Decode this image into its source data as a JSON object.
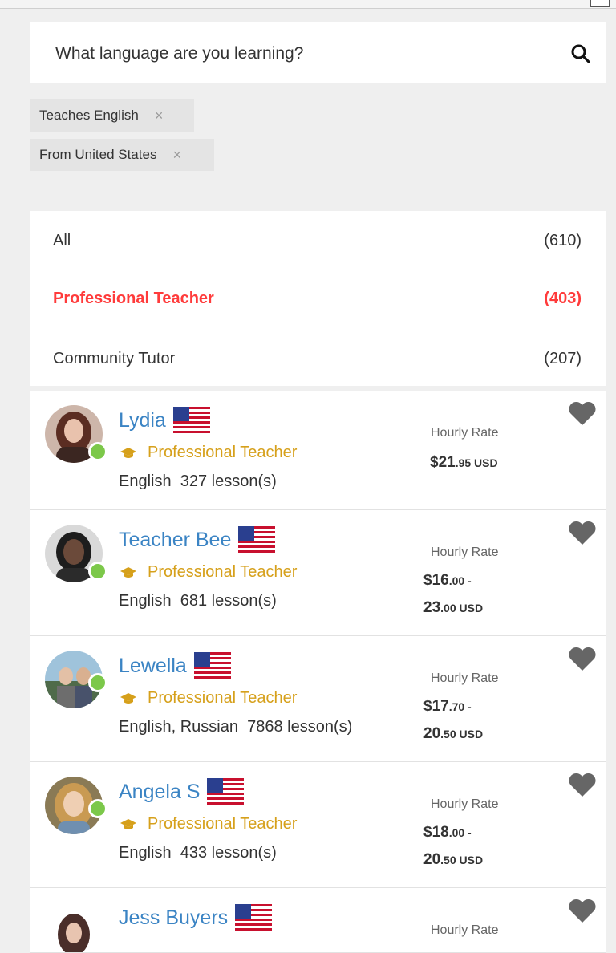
{
  "search": {
    "placeholder": "What language are you learning?"
  },
  "chips": [
    {
      "label": "Teaches English",
      "close": "×"
    },
    {
      "label": "From United States",
      "close": "×"
    }
  ],
  "filters": [
    {
      "label": "All",
      "count": "(610)"
    },
    {
      "label": "Professional Teacher",
      "count": "(403)"
    },
    {
      "label": "Community Tutor",
      "count": "(207)"
    }
  ],
  "teachers": [
    {
      "name": "Lydia",
      "badge": "Professional Teacher",
      "langs": "English",
      "lessons": "327 lesson(s)",
      "rate_label": "Hourly Rate",
      "price_main": "$21",
      "price_cents": ".95 USD"
    },
    {
      "name": "Teacher Bee",
      "badge": "Professional Teacher",
      "langs": "English",
      "lessons": "681 lesson(s)",
      "rate_label": "Hourly Rate",
      "price_main": "$16",
      "price_cents": ".00 -",
      "price2_main": "23",
      "price2_cents": ".00 USD"
    },
    {
      "name": "Lewella",
      "badge": "Professional Teacher",
      "langs": "English, Russian",
      "lessons": "7868 lesson(s)",
      "rate_label": "Hourly Rate",
      "price_main": "$17",
      "price_cents": ".70 -",
      "price2_main": "20",
      "price2_cents": ".50 USD"
    },
    {
      "name": "Angela S",
      "badge": "Professional Teacher",
      "langs": "English",
      "lessons": "433 lesson(s)",
      "rate_label": "Hourly Rate",
      "price_main": "$18",
      "price_cents": ".00 -",
      "price2_main": "20",
      "price2_cents": ".50 USD"
    },
    {
      "name": "Jess Buyers",
      "rate_label": "Hourly Rate"
    }
  ],
  "colors": {
    "link": "#3b84c4",
    "active": "#ff3b3b",
    "badge": "#d6a01b",
    "online": "#7cc84a"
  }
}
